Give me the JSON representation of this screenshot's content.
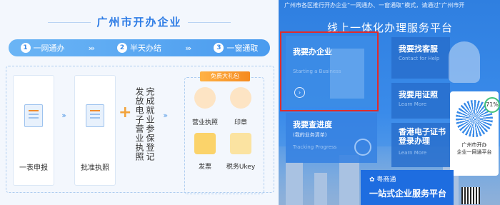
{
  "left_panel": {
    "title": "广州市开办企业",
    "steps": [
      {
        "num": "1",
        "label": "一网通办"
      },
      {
        "num": "2",
        "label": "半天办结"
      },
      {
        "num": "3",
        "label": "一窗通取"
      }
    ],
    "flow": {
      "apply": "一表申报",
      "license": "批准执照",
      "parallel_a": "发放电子营业执照",
      "parallel_b": "完成就业参保登记"
    },
    "gift": {
      "tag": "免费大礼包",
      "items": [
        "营业执照",
        "印章",
        "发票",
        "税务Ukey"
      ]
    }
  },
  "right_panel": {
    "top_note": "广州市各区推行开办企业“一网通办、一窗通取”模式，请通过“广州市开",
    "platform_title": "线上一体化办理服务平台",
    "tiles": {
      "open": {
        "title": "我要办企业",
        "subtitle": "Starting a Business"
      },
      "progress": {
        "title": "我要查进度",
        "note": "(我的业务清单)",
        "subtitle": "Tracking Progress"
      },
      "service": {
        "title": "我要找客服",
        "subtitle": "Contact for Help"
      },
      "cert": {
        "title": "我要用证照",
        "subtitle": "Learn More"
      },
      "hk": {
        "title": "香港电子证书登录办理",
        "subtitle": "Learn More"
      }
    },
    "arrow_glyph": "›",
    "yueshangtong": {
      "name": "粤商通",
      "slogan": "一站式企业服务平台"
    },
    "qr_card": {
      "percent": "71%",
      "caption_1": "广州市开办",
      "caption_2": "企业一网通平台"
    }
  }
}
